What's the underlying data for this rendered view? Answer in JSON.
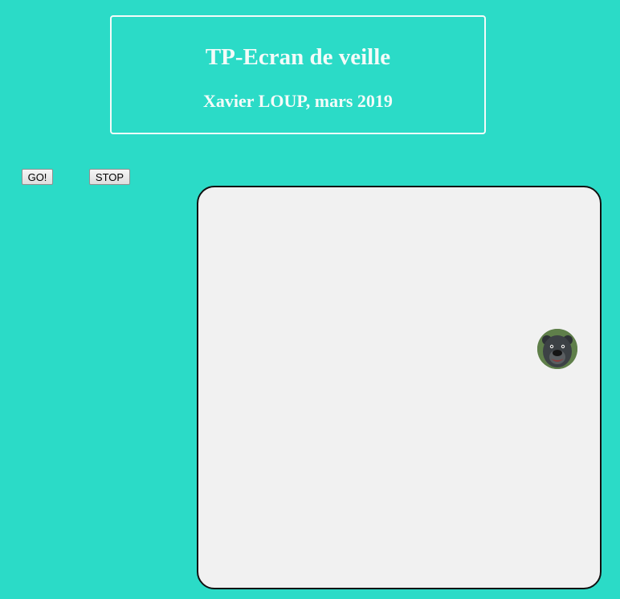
{
  "header": {
    "title": "TP-Ecran de veille",
    "subtitle": "Xavier LOUP, mars 2019"
  },
  "controls": {
    "go_label": "GO!",
    "stop_label": "STOP"
  },
  "stage": {
    "sprite_icon": "bear-face-icon"
  },
  "colors": {
    "background": "#2bdbc7",
    "header_text": "#f4fbf9",
    "stage_background": "#f1f1f1",
    "stage_border": "#111111"
  }
}
